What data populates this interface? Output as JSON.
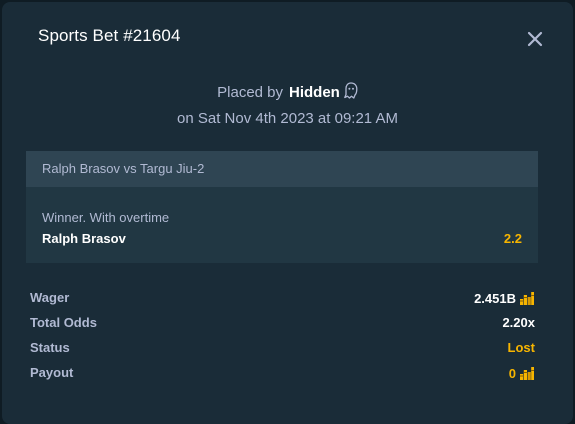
{
  "modal": {
    "title": "Sports Bet #21604",
    "placed_by_prefix": "Placed by",
    "placed_by_user": "Hidden",
    "placed_on": "on Sat Nov 4th 2023 at 09:21 AM"
  },
  "event": {
    "name": "Ralph Brasov vs Targu Jiu-2",
    "market": "Winner. With overtime",
    "selection": "Ralph Brasov",
    "odds": "2.2"
  },
  "summary": {
    "wager_label": "Wager",
    "wager_value": "2.451B",
    "total_odds_label": "Total Odds",
    "total_odds_value": "2.20x",
    "status_label": "Status",
    "status_value": "Lost",
    "payout_label": "Payout",
    "payout_value": "0"
  },
  "icons": {
    "close": "close-icon",
    "user_hidden": "ghost-icon",
    "currency": "gold-coin-icon"
  },
  "colors": {
    "background": "#1a2c38",
    "event_header": "#2f4553",
    "event_body": "#213743",
    "accent": "#f7b500",
    "muted_text": "#b1bad3"
  }
}
